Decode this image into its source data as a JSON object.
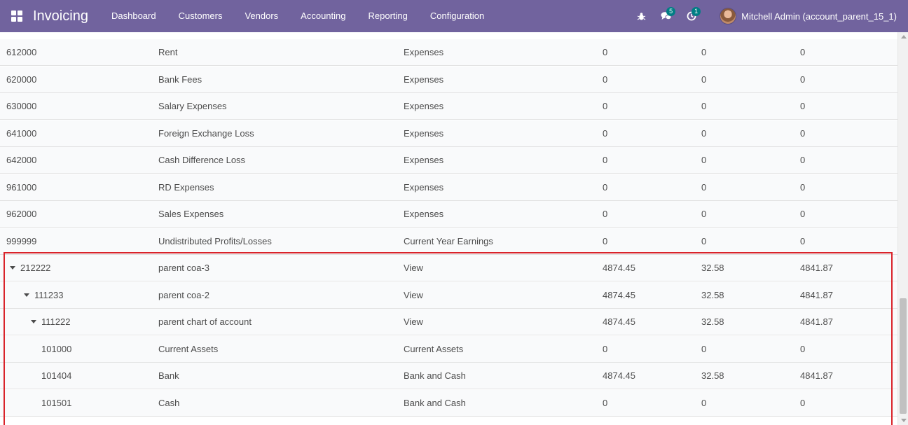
{
  "app": {
    "title": "Invoicing",
    "apps_icon": "apps-grid-icon",
    "menu": [
      "Dashboard",
      "Customers",
      "Vendors",
      "Accounting",
      "Reporting",
      "Configuration"
    ]
  },
  "systray": {
    "debug_icon": "bug-icon",
    "messages_icon": "chat-bubbles-icon",
    "messages_count": "5",
    "activities_icon": "clock-icon",
    "activities_count": "1",
    "user_name": "Mitchell Admin (account_parent_15_1)"
  },
  "table": {
    "rows": [
      {
        "code": "612000",
        "name": "Rent",
        "type": "Expenses",
        "v1": "0",
        "v2": "0",
        "v3": "0",
        "level": 0,
        "expandable": false
      },
      {
        "code": "620000",
        "name": "Bank Fees",
        "type": "Expenses",
        "v1": "0",
        "v2": "0",
        "v3": "0",
        "level": 0,
        "expandable": false
      },
      {
        "code": "630000",
        "name": "Salary Expenses",
        "type": "Expenses",
        "v1": "0",
        "v2": "0",
        "v3": "0",
        "level": 0,
        "expandable": false
      },
      {
        "code": "641000",
        "name": "Foreign Exchange Loss",
        "type": "Expenses",
        "v1": "0",
        "v2": "0",
        "v3": "0",
        "level": 0,
        "expandable": false
      },
      {
        "code": "642000",
        "name": "Cash Difference Loss",
        "type": "Expenses",
        "v1": "0",
        "v2": "0",
        "v3": "0",
        "level": 0,
        "expandable": false
      },
      {
        "code": "961000",
        "name": "RD Expenses",
        "type": "Expenses",
        "v1": "0",
        "v2": "0",
        "v3": "0",
        "level": 0,
        "expandable": false
      },
      {
        "code": "962000",
        "name": "Sales Expenses",
        "type": "Expenses",
        "v1": "0",
        "v2": "0",
        "v3": "0",
        "level": 0,
        "expandable": false
      },
      {
        "code": "999999",
        "name": "Undistributed Profits/Losses",
        "type": "Current Year Earnings",
        "v1": "0",
        "v2": "0",
        "v3": "0",
        "level": 0,
        "expandable": false
      },
      {
        "code": "212222",
        "name": "parent coa-3",
        "type": "View",
        "v1": "4874.45",
        "v2": "32.58",
        "v3": "4841.87",
        "level": 1,
        "expandable": true
      },
      {
        "code": "111233",
        "name": "parent coa-2",
        "type": "View",
        "v1": "4874.45",
        "v2": "32.58",
        "v3": "4841.87",
        "level": 2,
        "expandable": true
      },
      {
        "code": "111222",
        "name": "parent chart of account",
        "type": "View",
        "v1": "4874.45",
        "v2": "32.58",
        "v3": "4841.87",
        "level": 3,
        "expandable": true
      },
      {
        "code": "101000",
        "name": "Current Assets",
        "type": "Current Assets",
        "v1": "0",
        "v2": "0",
        "v3": "0",
        "level": 4,
        "expandable": false
      },
      {
        "code": "101404",
        "name": "Bank",
        "type": "Bank and Cash",
        "v1": "4874.45",
        "v2": "32.58",
        "v3": "4841.87",
        "level": 4,
        "expandable": false
      },
      {
        "code": "101501",
        "name": "Cash",
        "type": "Bank and Cash",
        "v1": "0",
        "v2": "0",
        "v3": "0",
        "level": 4,
        "expandable": false
      }
    ]
  },
  "colors": {
    "navbar": "#71639e",
    "badge": "#017e84",
    "highlight_border": "#d9232a"
  }
}
